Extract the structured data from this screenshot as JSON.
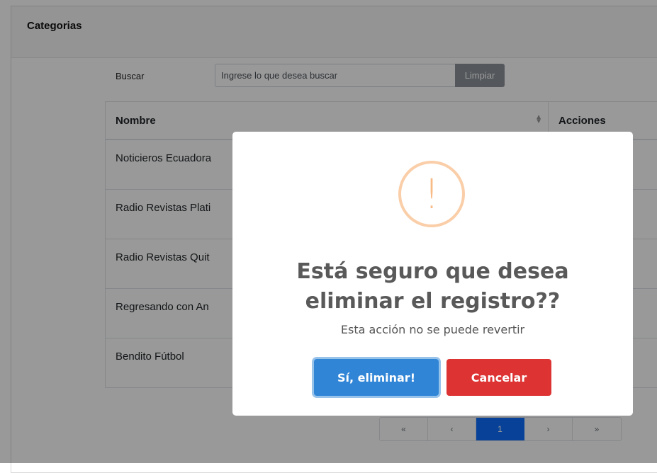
{
  "card": {
    "title": "Categorias"
  },
  "search": {
    "label": "Buscar",
    "placeholder": "Ingrese lo que desea buscar",
    "clear_label": "Limpiar"
  },
  "table": {
    "headers": [
      "Nombre",
      "Acciones"
    ],
    "rows": [
      {
        "name": "Noticieros Ecuadora"
      },
      {
        "name": "Radio Revistas Plati"
      },
      {
        "name": "Radio Revistas Quit"
      },
      {
        "name": "Regresando con An"
      },
      {
        "name": "Bendito Fútbol"
      }
    ]
  },
  "pagination": {
    "first": "«",
    "prev": "‹",
    "current": "1",
    "next": "›",
    "last": "»"
  },
  "dialog": {
    "icon": "!",
    "title": "Está seguro que desea eliminar el registro??",
    "text": "Esta acción no se puede revertir",
    "confirm_label": "Sí, eliminar!",
    "cancel_label": "Cancelar"
  },
  "colors": {
    "confirm": "#3085d6",
    "cancel": "#dd3333",
    "warning": "#f8bb86",
    "active_page": "#0d6efd"
  }
}
